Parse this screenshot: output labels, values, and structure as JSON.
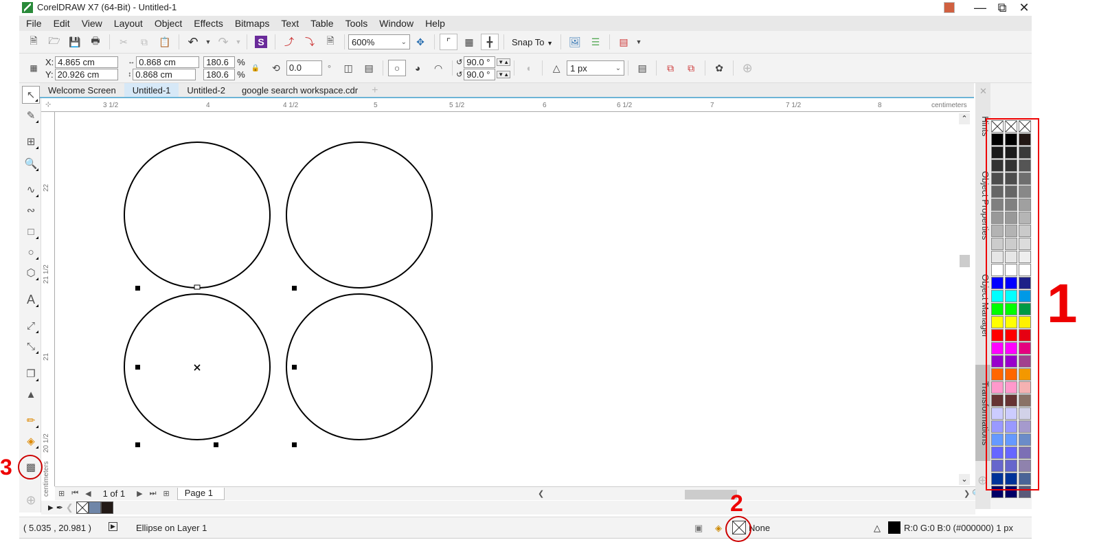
{
  "window": {
    "title": "CorelDRAW X7 (64-Bit) - Untitled-1",
    "controls": [
      "minimize",
      "restore",
      "close"
    ]
  },
  "menubar": {
    "items": [
      "File",
      "Edit",
      "View",
      "Layout",
      "Object",
      "Effects",
      "Bitmaps",
      "Text",
      "Table",
      "Tools",
      "Window",
      "Help"
    ]
  },
  "standard_toolbar": {
    "zoom_level": "600%",
    "snap_to_label": "Snap To",
    "icons": [
      "new-document-icon",
      "open-icon",
      "save-icon",
      "print-icon",
      "cut-icon",
      "copy-icon",
      "paste-icon",
      "undo-icon",
      "redo-icon",
      "corel-connect-icon",
      "import-icon",
      "export-icon",
      "publish-pdf-icon",
      "full-screen-icon",
      "rulers-icon",
      "grid-icon",
      "guidelines-icon",
      "options-icon",
      "app-launcher-icon",
      "welcome-screen-icon"
    ]
  },
  "property_bar": {
    "x_label": "X:",
    "x_value": "4.865 cm",
    "y_label": "Y:",
    "y_value": "20.926 cm",
    "width_value": "0.868 cm",
    "height_value": "0.868 cm",
    "scale_x": "180.6",
    "scale_y": "180.6",
    "percent_symbol": "%",
    "rotation_value": "0.0",
    "degree_symbol": "°",
    "start_angle": "90.0 °",
    "end_angle": "90.0 °",
    "outline_width": "1 px"
  },
  "doc_tabs": [
    {
      "label": "Welcome Screen",
      "active": false
    },
    {
      "label": "Untitled-1",
      "active": true
    },
    {
      "label": "Untitled-2",
      "active": false
    },
    {
      "label": "google search workspace.cdr",
      "active": false
    }
  ],
  "rulers": {
    "horizontal_ticks": [
      "3 1/2",
      "4",
      "4 1/2",
      "5",
      "5 1/2",
      "6",
      "6 1/2",
      "7",
      "7 1/2",
      "8"
    ],
    "horizontal_unit": "centimeters",
    "vertical_ticks": [
      "22",
      "21 1/2",
      "21",
      "20 1/2"
    ],
    "vertical_unit": "centimeters"
  },
  "canvas": {
    "objects": [
      {
        "type": "ellipse",
        "label": "circle-top-left",
        "selected": false
      },
      {
        "type": "ellipse",
        "label": "circle-top-right",
        "selected": false
      },
      {
        "type": "ellipse",
        "label": "circle-bottom-left",
        "selected": true
      },
      {
        "type": "ellipse",
        "label": "circle-bottom-right",
        "selected": false
      }
    ]
  },
  "page_nav": {
    "page_count": "1 of 1",
    "page_tab": "Page 1"
  },
  "document_palette": {
    "swatches": [
      "none",
      "#6f86a8",
      "#221a16"
    ]
  },
  "status": {
    "cursor_position": "( 5.035 , 20.981 )",
    "object_info": "Ellipse on Layer 1",
    "fill_label": "None",
    "outline_info": "R:0 G:0 B:0 (#000000) 1 px",
    "outline_color": "#000000"
  },
  "dockers": [
    "Hints",
    "Object Properties",
    "Object Manager",
    "Transformations"
  ],
  "color_palettes": {
    "columns": [
      [
        "none",
        "#000000",
        "#1a1a1a",
        "#333333",
        "#4d4d4d",
        "#666666",
        "#808080",
        "#999999",
        "#b3b3b3",
        "#cccccc",
        "#e6e6e6",
        "#ffffff",
        "#0000ff",
        "#00ffff",
        "#00ff00",
        "#ffff00",
        "#ff0000",
        "#ff00ff",
        "#9900cc",
        "#ff6600",
        "#ff99cc",
        "#663333",
        "#ccccff",
        "#9999ff",
        "#6699ff",
        "#6666ff",
        "#6666cc",
        "#003399",
        "#000066"
      ],
      [
        "none",
        "#000000",
        "#1a1a1a",
        "#333333",
        "#4d4d4d",
        "#666666",
        "#808080",
        "#999999",
        "#b3b3b3",
        "#cccccc",
        "#e6e6e6",
        "#ffffff",
        "#0000ff",
        "#00ffff",
        "#00ff00",
        "#ffff00",
        "#ff0000",
        "#ff00ff",
        "#9900cc",
        "#ff6600",
        "#ff99cc",
        "#663333",
        "#ccccff",
        "#9999ff",
        "#6699ff",
        "#6666ff",
        "#6666cc",
        "#003399",
        "#000066"
      ],
      [
        "none",
        "#231815",
        "#3a3a3a",
        "#555555",
        "#6e6e6e",
        "#888888",
        "#a0a0a0",
        "#b5b5b5",
        "#cacaca",
        "#dcdcdc",
        "#eeeeee",
        "#ffffff",
        "#1d2088",
        "#0099e6",
        "#009944",
        "#fff100",
        "#e60012",
        "#e4007f",
        "#a2408e",
        "#f39800",
        "#f5b2b2",
        "#8a7266",
        "#d2d2e8",
        "#a59acd",
        "#6b8cc8",
        "#7c6fb5",
        "#8f82ad",
        "#4a6497",
        "#5a5a7a"
      ]
    ]
  },
  "annotations": {
    "palette_number": "1",
    "fill_number": "2",
    "tool_number": "3",
    "color": "#e00000"
  }
}
